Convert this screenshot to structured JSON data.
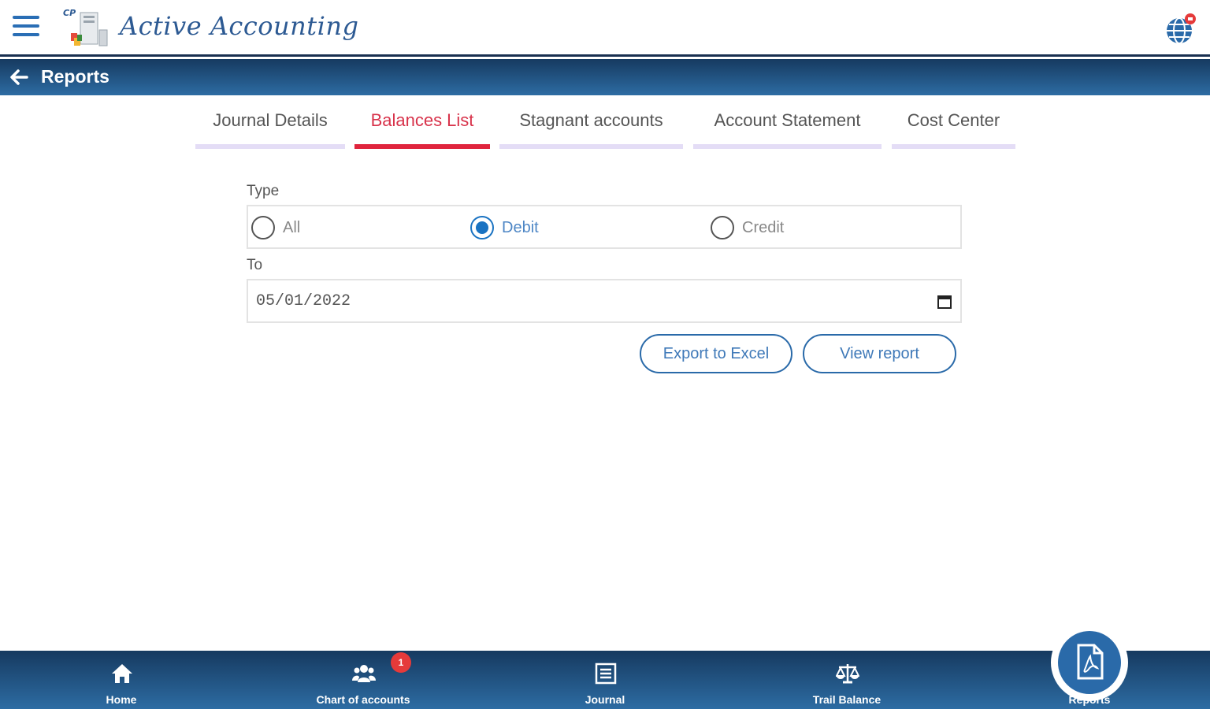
{
  "header": {
    "app_name": "Active Accounting",
    "menu_icon": "hamburger-menu-icon",
    "language_icon": "globe-icon"
  },
  "titlebar": {
    "title": "Reports",
    "back_icon": "arrow-left-icon"
  },
  "tabs": [
    {
      "label": "Journal Details",
      "active": false
    },
    {
      "label": "Balances List",
      "active": true
    },
    {
      "label": "Stagnant accounts",
      "active": false
    },
    {
      "label": "Account Statement",
      "active": false
    },
    {
      "label": "Cost Center",
      "active": false
    }
  ],
  "form": {
    "type_label": "Type",
    "type_options": [
      {
        "label": "All",
        "checked": false
      },
      {
        "label": "Debit",
        "checked": true
      },
      {
        "label": "Credit",
        "checked": false
      }
    ],
    "to_label": "To",
    "to_value": "05/01/2022"
  },
  "buttons": {
    "export_label": "Export to Excel",
    "view_label": "View report"
  },
  "bottom_nav": {
    "items": [
      {
        "label": "Home",
        "icon": "home-icon"
      },
      {
        "label": "Chart of accounts",
        "icon": "users-icon",
        "badge": "1"
      },
      {
        "label": "Journal",
        "icon": "journal-icon"
      },
      {
        "label": "Trail Balance",
        "icon": "balance-scale-icon"
      },
      {
        "label": "Reports",
        "icon": "pdf-file-icon",
        "active": true
      }
    ]
  },
  "colors": {
    "primary": "#2a6aa9",
    "header_dark": "#163a60",
    "active_tab": "#e0243d",
    "badge": "#e53a3a"
  }
}
